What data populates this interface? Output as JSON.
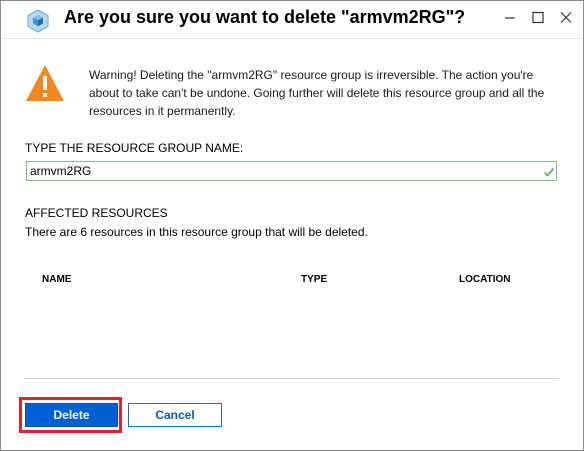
{
  "dialog": {
    "title": "Are you sure you want to delete \"armvm2RG\"?",
    "warning": "Warning! Deleting the \"armvm2RG\" resource group is irreversible. The action you're about to take can't be undone. Going further will delete this resource group and all the resources in it permanently.",
    "type_label": "TYPE THE RESOURCE GROUP NAME:",
    "name_input_value": "armvm2RG",
    "affected_label": "AFFECTED RESOURCES",
    "affected_desc": "There are 6 resources in this resource group that will be deleted.",
    "columns": [
      "NAME",
      "TYPE",
      "LOCATION"
    ],
    "delete_label": "Delete",
    "cancel_label": "Cancel"
  },
  "colors": {
    "accent": "#0060d6",
    "warning": "#f5871f",
    "highlight": "#e0242d",
    "valid": "#5cb85c"
  },
  "icons": {
    "app": "resource-group-cube-icon",
    "warning": "warning-triangle-icon",
    "valid": "checkmark-icon",
    "minimize": "minimize-icon",
    "maximize": "maximize-icon",
    "close": "close-icon"
  }
}
